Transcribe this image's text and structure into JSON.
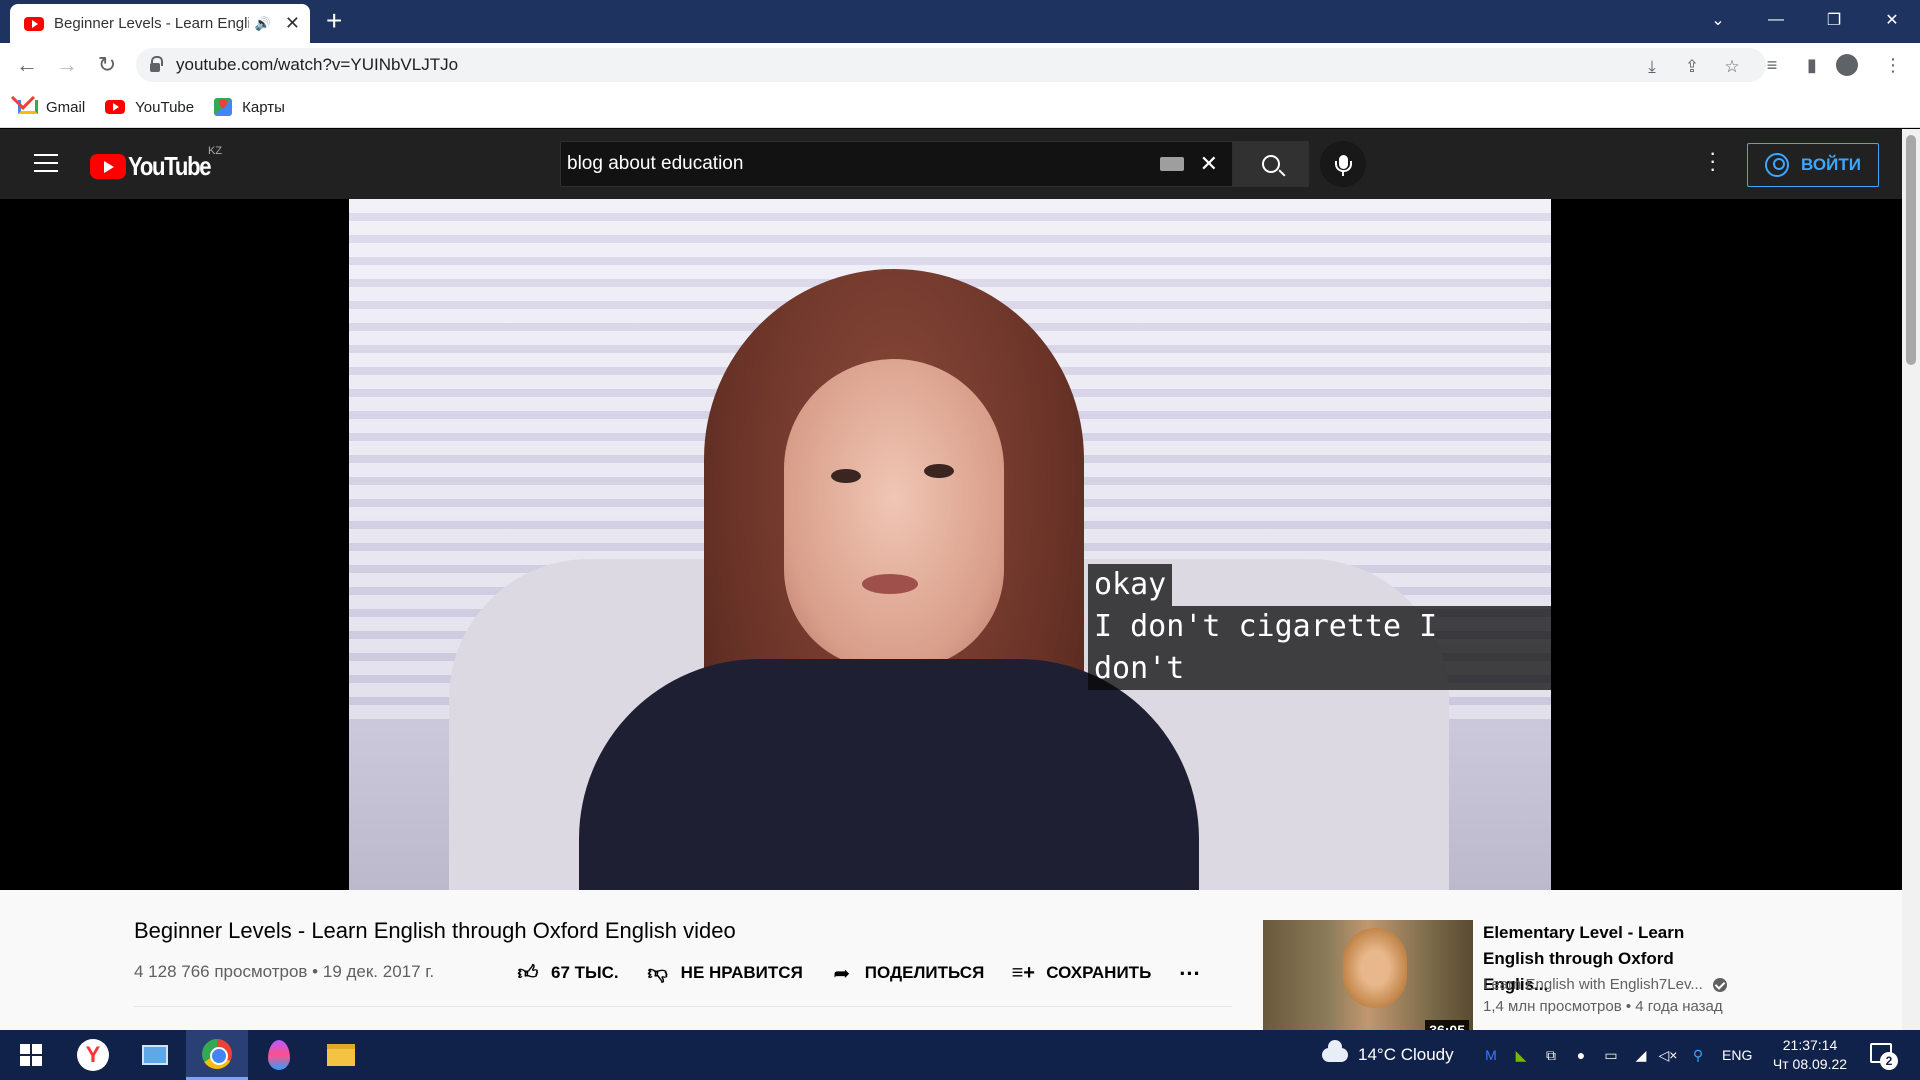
{
  "browser": {
    "tab_title": "Beginner Levels - Learn Engli",
    "url": "youtube.com/watch?v=YUINbVLJTJo",
    "bookmarks": [
      {
        "label": "Gmail",
        "icon": "gmail-icon"
      },
      {
        "label": "YouTube",
        "icon": "youtube-icon"
      },
      {
        "label": "Карты",
        "icon": "maps-icon"
      }
    ]
  },
  "youtube": {
    "region": "KZ",
    "logo_text": "YouTube",
    "search_value": "blog about education",
    "signin_label": "ВОЙТИ"
  },
  "video": {
    "captions": [
      "okay",
      "I don't cigarette I don't"
    ],
    "title": "Beginner Levels - Learn English through Oxford English video",
    "views_date": "4 128 766 просмотров • 19 дек. 2017 г.",
    "likes_label": "67 ТЫС.",
    "dislike_label": "НЕ НРАВИТСЯ",
    "share_label": "ПОДЕЛИТЬСЯ",
    "save_label": "СОХРАНИТЬ"
  },
  "recommendation": {
    "title": "Elementary Level - Learn English through Oxford Englis...",
    "channel": "Learn English with English7Lev...",
    "meta": "1,4 млн просмотров • 4 года назад",
    "duration": "36:05"
  },
  "taskbar": {
    "weather": "14°C  Cloudy",
    "language": "ENG",
    "time": "21:37:14",
    "date": "Чт 08.09.22",
    "notifications": "2"
  },
  "colors": {
    "tabstrip": "#1f3360",
    "yt_header": "#212121",
    "signin_accent": "#3ea6ff",
    "taskbar": "#10214a"
  }
}
